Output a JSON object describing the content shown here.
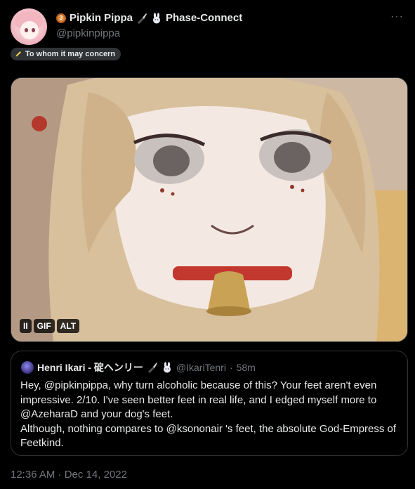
{
  "author": {
    "display_name": "Pipkin Pippa",
    "medal_glyph": "3",
    "affiliation": "Phase-Connect",
    "handle": "@pipkinpippa",
    "avatar_icon": "avatar-pink-hair-girl"
  },
  "menu": {
    "more_glyph": "···"
  },
  "label_pill": {
    "text": "To whom it may concern",
    "icon": "pencil-icon"
  },
  "media": {
    "type": "gif",
    "controls": {
      "pause": "II",
      "gif": "GIF",
      "alt": "ALT"
    }
  },
  "quoted_tweet": {
    "display_name": "Henri Ikari - 碇ヘンリー",
    "handle": "@IkariTenri",
    "separator": "·",
    "time_ago": "58m",
    "text": "Hey, @pipkinpippa, why turn alcoholic because of this? Your feet aren't even impressive. 2/10. I've seen better feet in real life, and I edged myself more to @AzeharaD and your dog's feet.\nAlthough, nothing compares to @ksononair 's feet, the absolute God-Empress of Feetkind."
  },
  "timestamp": "12:36 AM · Dec 14, 2022",
  "colors": {
    "background": "#000000",
    "text_primary": "#e7e9ea",
    "text_secondary": "#71767b",
    "border": "#2f3336"
  }
}
